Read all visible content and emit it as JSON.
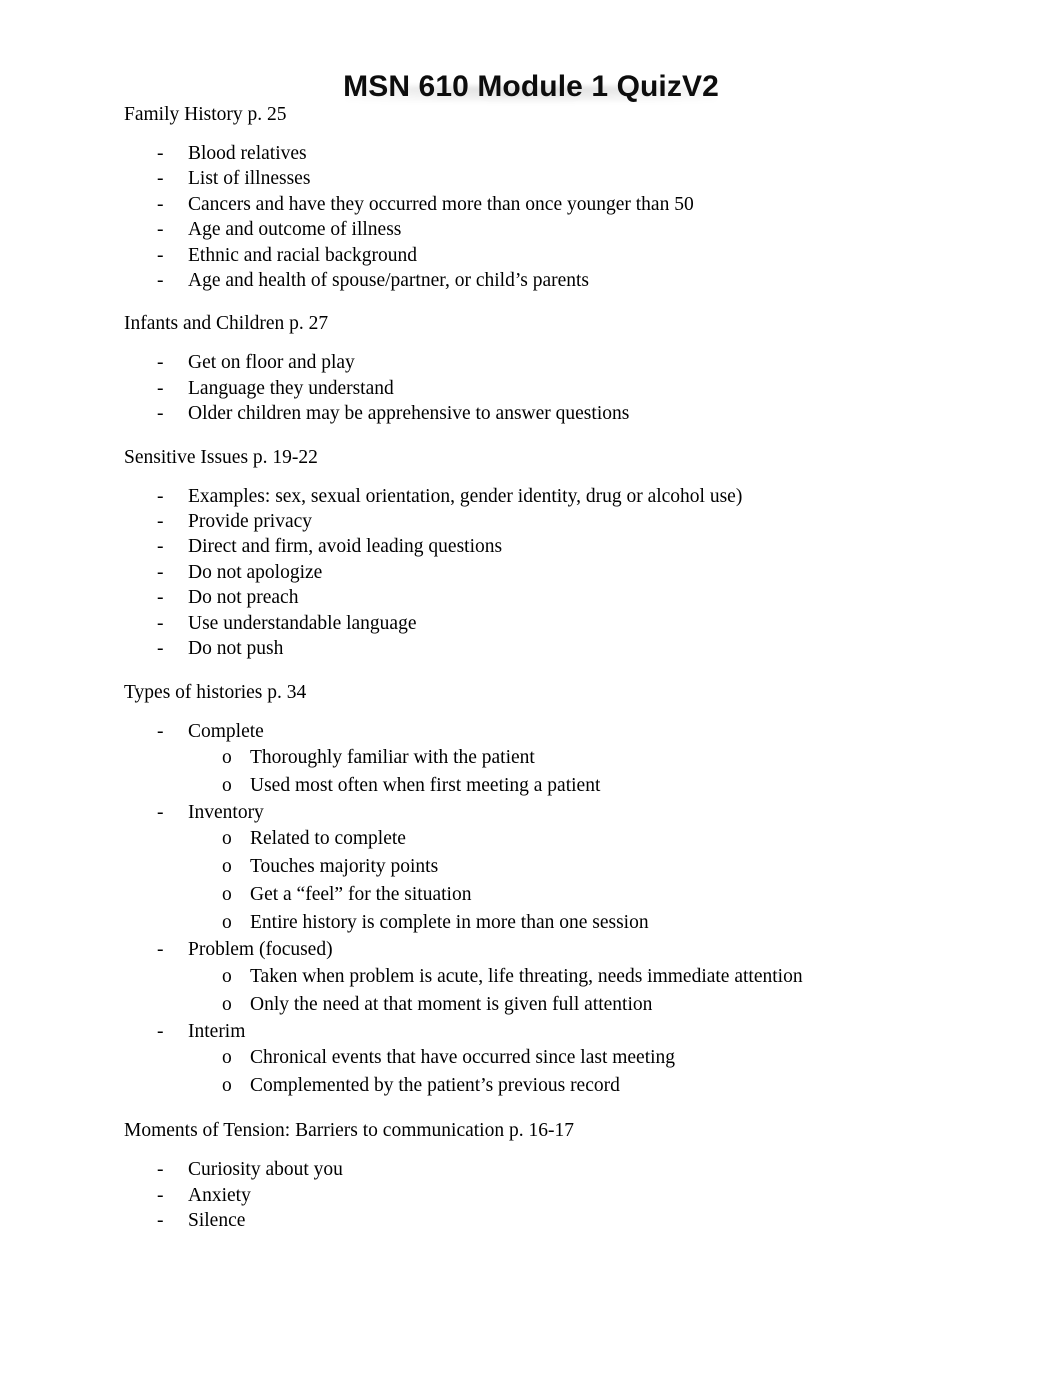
{
  "document": {
    "title": "MSN 610 Module 1 QuizV2",
    "background_color": "#ffffff",
    "text_color": "#000000",
    "bullet_marker": "-",
    "sub_bullet_marker": "o"
  },
  "sections": [
    {
      "heading": "Family History p. 25",
      "items": [
        {
          "text": "Blood relatives"
        },
        {
          "text": "List of illnesses"
        },
        {
          "text": "Cancers and have they occurred more than once younger than 50"
        },
        {
          "text": "Age and outcome of illness"
        },
        {
          "text": "Ethnic and racial background"
        },
        {
          "text": "Age and health of spouse/partner, or child’s parents"
        }
      ]
    },
    {
      "heading": "Infants and Children p. 27",
      "items": [
        {
          "text": "Get on floor and play"
        },
        {
          "text": "Language they understand"
        },
        {
          "text": "Older children may be apprehensive to answer questions"
        }
      ]
    },
    {
      "heading": "Sensitive Issues p. 19-22",
      "items": [
        {
          "text": "Examples: sex, sexual orientation, gender identity, drug or alcohol use)"
        },
        {
          "text": "Provide privacy"
        },
        {
          "text": "Direct and firm, avoid leading questions"
        },
        {
          "text": "Do not apologize"
        },
        {
          "text": "Do not preach"
        },
        {
          "text": "Use understandable language"
        },
        {
          "text": "Do not push"
        }
      ]
    },
    {
      "heading": "Types of histories p. 34",
      "items": [
        {
          "text": "Complete",
          "subitems": [
            "Thoroughly familiar with the patient",
            "Used most often when first meeting a patient"
          ]
        },
        {
          "text": "Inventory",
          "subitems": [
            "Related to complete",
            "Touches majority points",
            "Get a “feel” for the situation",
            "Entire history is complete in more than one session"
          ]
        },
        {
          "text": "Problem (focused)",
          "subitems": [
            "Taken when problem is acute, life threating, needs immediate attention",
            "Only the need at that moment is given full attention"
          ]
        },
        {
          "text": "Interim",
          "subitems": [
            "Chronical events that have occurred since last meeting",
            "Complemented by the patient’s previous record"
          ]
        }
      ]
    },
    {
      "heading": "Moments of Tension: Barriers to communication p. 16-17",
      "items": [
        {
          "text": "Curiosity about you"
        },
        {
          "text": "Anxiety"
        },
        {
          "text": "Silence"
        }
      ]
    }
  ]
}
